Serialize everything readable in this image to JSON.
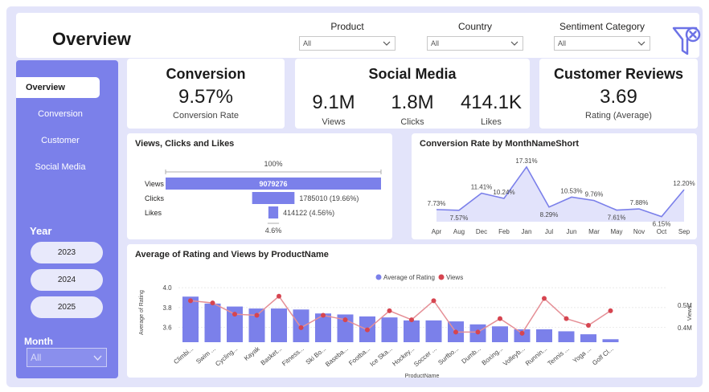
{
  "header": {
    "title": "Overview",
    "filters": [
      {
        "label": "Product",
        "value": "All"
      },
      {
        "label": "Country",
        "value": "All"
      },
      {
        "label": "Sentiment Category",
        "value": "All"
      }
    ]
  },
  "sidebar": {
    "nav": [
      "Overview",
      "Conversion",
      "Customer",
      "Social Media"
    ],
    "year_heading": "Year",
    "years": [
      "2023",
      "2024",
      "2025"
    ],
    "month_heading": "Month",
    "month_value": "All"
  },
  "kpis": {
    "conversion": {
      "title": "Conversion",
      "value": "9.57%",
      "label": "Conversion Rate"
    },
    "social": {
      "title": "Social Media",
      "metrics": [
        {
          "value": "9.1M",
          "label": "Views"
        },
        {
          "value": "1.8M",
          "label": "Clicks"
        },
        {
          "value": "414.1K",
          "label": "Likes"
        }
      ]
    },
    "reviews": {
      "title": "Customer Reviews",
      "value": "3.69",
      "label": "Rating (Average)"
    }
  },
  "chart_data": [
    {
      "type": "bar",
      "subtype": "funnel",
      "title": "Views, Clicks and Likes",
      "top_label": "100%",
      "bottom_label": "4.6%",
      "categories": [
        "Views",
        "Clicks",
        "Likes"
      ],
      "values": [
        9079276,
        1785010,
        414122
      ],
      "data_labels": [
        "9079276",
        "1785010 (19.66%)",
        "414122 (4.56%)"
      ],
      "color": "#7b80ea"
    },
    {
      "type": "area",
      "title": "Conversion Rate by MonthNameShort",
      "categories": [
        "Apr",
        "Aug",
        "Dec",
        "Feb",
        "Jan",
        "Jul",
        "Jun",
        "Mar",
        "May",
        "Nov",
        "Oct",
        "Sep"
      ],
      "values": [
        7.73,
        7.57,
        11.41,
        10.24,
        17.31,
        8.29,
        10.53,
        9.76,
        7.61,
        7.88,
        6.15,
        12.2
      ],
      "data_labels": [
        "7.73%",
        "7.57%",
        "11.41%",
        "10.24%",
        "17.31%",
        "8.29%",
        "10.53%",
        "9.76%",
        "7.61%",
        "7.88%",
        "6.15%",
        "12.20%"
      ],
      "ylim": [
        5,
        18
      ],
      "color": "#7b80ea"
    },
    {
      "type": "bar",
      "subtype": "bar-line-combo",
      "title": "Average of Rating and Views by ProductName",
      "xlabel": "ProductName",
      "ylabel": "Average of Rating",
      "y2label": "Views",
      "legend_position": "top",
      "categories": [
        "Climbi...",
        "Swim ...",
        "Cycling...",
        "Kayak",
        "Basket...",
        "Fitness...",
        "Ski Bo...",
        "Baseba...",
        "Footba...",
        "Ice Ska...",
        "Hockey...",
        "Soccer ...",
        "Surfbo...",
        "Dumb...",
        "Boxing...",
        "Volleyb...",
        "Runnin...",
        "Tennis ...",
        "Yoga ...",
        "Golf Cl..."
      ],
      "y_ticks": [
        "4.0",
        "3.8",
        "3.6"
      ],
      "y2_ticks": [
        "0.5M",
        "0.4M"
      ],
      "ylim": [
        3.45,
        4.05
      ],
      "y2lim": [
        0.335,
        0.6
      ],
      "series": [
        {
          "name": "Average of Rating",
          "type": "bar",
          "color": "#7b80ea",
          "values": [
            3.91,
            3.84,
            3.81,
            3.79,
            3.79,
            3.78,
            3.74,
            3.73,
            3.71,
            3.7,
            3.67,
            3.67,
            3.66,
            3.63,
            3.61,
            3.58,
            3.58,
            3.56,
            3.53,
            3.48
          ]
        },
        {
          "name": "Views",
          "type": "line",
          "color": "#d64550",
          "values": [
            0.52,
            0.51,
            0.46,
            0.455,
            0.54,
            0.4,
            0.455,
            0.435,
            0.39,
            0.475,
            0.435,
            0.52,
            0.38,
            0.38,
            0.44,
            0.375,
            0.53,
            0.44,
            0.41,
            0.475
          ]
        }
      ]
    }
  ]
}
